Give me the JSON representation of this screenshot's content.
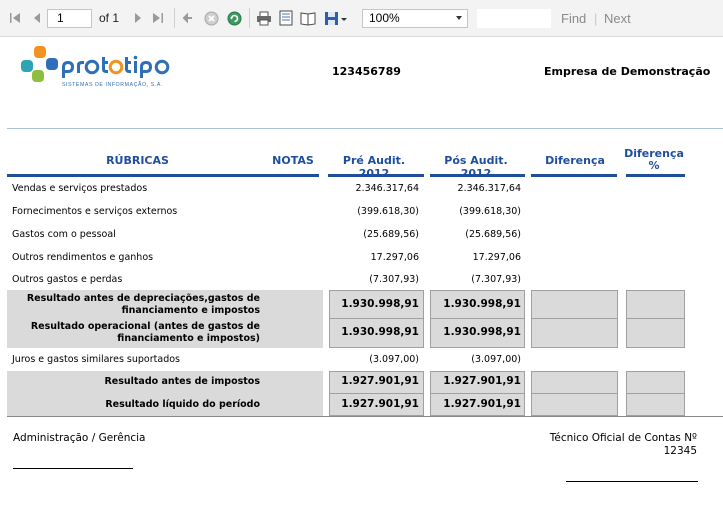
{
  "toolbar": {
    "page_value": "1",
    "of_label": "of",
    "total_pages": "1",
    "zoom": "100%",
    "find_label": "Find",
    "find_sep": "|",
    "next_label": "Next",
    "icons": [
      "first-page-icon",
      "prev-page-icon",
      "next-page-icon",
      "last-page-icon",
      "back-icon",
      "stop-icon",
      "refresh-icon",
      "print-icon",
      "page-setup-icon",
      "print-layout-icon",
      "export-icon"
    ]
  },
  "report": {
    "logo": {
      "text": "prototipo",
      "subtitle": "SISTEMAS DE INFORMAÇÃO, S.A.",
      "colors": [
        "#2f6fb7",
        "#f29321",
        "#8cbf3f",
        "#2da6b3"
      ]
    },
    "nif": "123456789",
    "company": "Empresa de Demonstração",
    "columns": {
      "rubricas": "RÚBRICAS",
      "notas": "NOTAS",
      "pre": "Pré Audit. 2012",
      "pos": "Pós Audit. 2012",
      "diferenca": "Diferença",
      "diferenca_pct_1": "Diferença",
      "diferenca_pct_2": "%"
    },
    "rows": [
      {
        "label": "Vendas e serviços prestados",
        "pre": "2.346.317,64",
        "pos": "2.346.317,64"
      },
      {
        "label": "Fornecimentos e serviços externos",
        "pre": "(399.618,30)",
        "pos": "(399.618,30)"
      },
      {
        "label": "Gastos com o pessoal",
        "pre": "(25.689,56)",
        "pos": "(25.689,56)"
      },
      {
        "label": "Outros rendimentos e ganhos",
        "pre": "17.297,06",
        "pos": "17.297,06"
      },
      {
        "label": "Outros gastos e perdas",
        "pre": "(7.307,93)",
        "pos": "(7.307,93)"
      }
    ],
    "subtotals": [
      {
        "label1": "Resultado antes de depreciações,gastos de",
        "label2": "financiamento e impostos",
        "pre": "1.930.998,91",
        "pos": "1.930.998,91"
      },
      {
        "label1": "Resultado operacional (antes de gastos de",
        "label2": "financiamento e impostos)",
        "pre": "1.930.998,91",
        "pos": "1.930.998,91"
      }
    ],
    "interest_row": {
      "label": "Juros e gastos similares suportados",
      "pre": "(3.097,00)",
      "pos": "(3.097,00)"
    },
    "totals": [
      {
        "label": "Resultado antes de impostos",
        "pre": "1.927.901,91",
        "pos": "1.927.901,91"
      },
      {
        "label": "Resultado líquido do período",
        "pre": "1.927.901,91",
        "pos": "1.927.901,91"
      }
    ],
    "signatures": {
      "left": "Administração / Gerência",
      "right": "Técnico Oficial de Contas Nº",
      "right_number": "12345"
    }
  }
}
